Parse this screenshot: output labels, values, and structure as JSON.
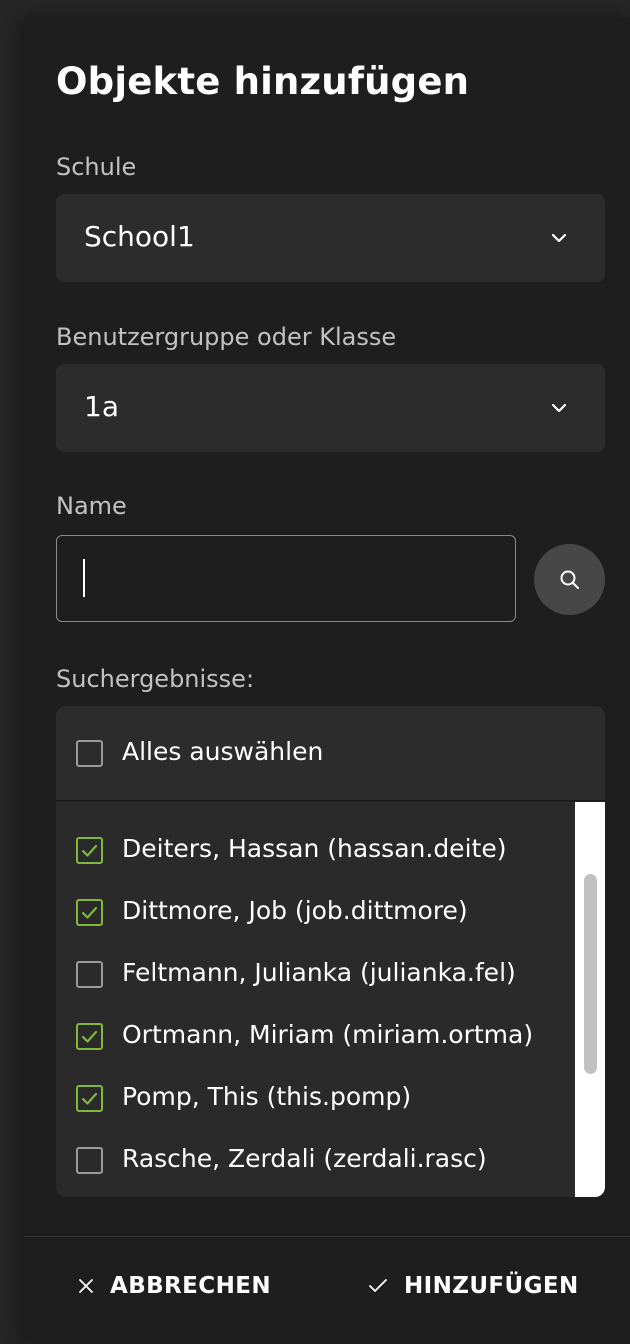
{
  "dialog": {
    "title": "Objekte hinzufügen"
  },
  "school": {
    "label": "Schule",
    "value": "School1"
  },
  "group": {
    "label": "Benutzergruppe oder Klasse",
    "value": "1a"
  },
  "name_search": {
    "label": "Name",
    "value": "",
    "placeholder": ""
  },
  "results": {
    "label": "Suchergebnisse:",
    "select_all": "Alles auswählen",
    "select_all_checked": false,
    "items": [
      {
        "label": "Deiters, Hassan (hassan.deite)",
        "checked": true
      },
      {
        "label": "Dittmore, Job (job.dittmore)",
        "checked": true
      },
      {
        "label": "Feltmann, Julianka (julianka.fel)",
        "checked": false
      },
      {
        "label": "Ortmann, Miriam (miriam.ortma)",
        "checked": true
      },
      {
        "label": "Pomp, This (this.pomp)",
        "checked": true
      },
      {
        "label": "Rasche, Zerdali (zerdali.rasc)",
        "checked": false
      }
    ]
  },
  "footer": {
    "cancel_label": "ABBRECHEN",
    "add_label": "HINZUFÜGEN"
  },
  "colors": {
    "dialog_bg": "#1e1e1e",
    "field_bg": "#2c2c2c",
    "checkbox_checked": "#7fb83a"
  },
  "icons": {
    "school_dropdown": "chevron-down-icon",
    "group_dropdown": "chevron-down-icon",
    "search": "search-icon",
    "cancel": "close-icon",
    "add": "check-icon"
  }
}
